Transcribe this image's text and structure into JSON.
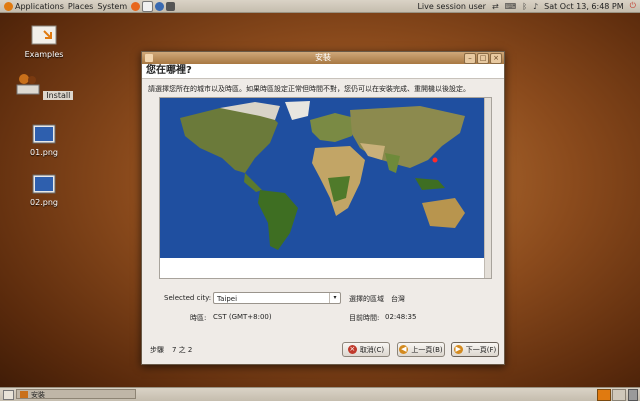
{
  "top_panel": {
    "menus": [
      "Applications",
      "Places",
      "System"
    ],
    "session_user": "Live session user",
    "clock": "Sat Oct 13,  6:48 PM"
  },
  "desktop_icons": [
    {
      "label": "Examples",
      "icon": "folder-icon"
    },
    {
      "label": "Install",
      "icon": "installer-icon"
    },
    {
      "label": "01.png",
      "icon": "image-file-icon"
    },
    {
      "label": "02.png",
      "icon": "image-file-icon"
    }
  ],
  "window": {
    "title": "安裝",
    "heading": "您在哪裡?",
    "instructions": "請選擇您所在的城市以及時區。如果時區設定正常但時間不對，您仍可以在安裝完成、重開機以後設定。",
    "selected_city_label": "Selected city:",
    "selected_city_value": "Taipei",
    "region_label": "選擇的區域",
    "region_value": "台灣",
    "timezone_label": "時區:",
    "timezone_value": "CST (GMT+8:00)",
    "current_time_label": "目前時間:",
    "current_time_value": "02:48:35",
    "step_label": "步驟",
    "step_value": "7 之 2",
    "buttons": {
      "cancel": "取消(C)",
      "back": "上一頁(B)",
      "forward": "下一頁(F)"
    }
  },
  "taskbar": {
    "task_label": "安裝"
  },
  "colors": {
    "panel": "#d3ccbf",
    "ocean": "#1f4fa0",
    "titlebar": "#b9894f"
  }
}
